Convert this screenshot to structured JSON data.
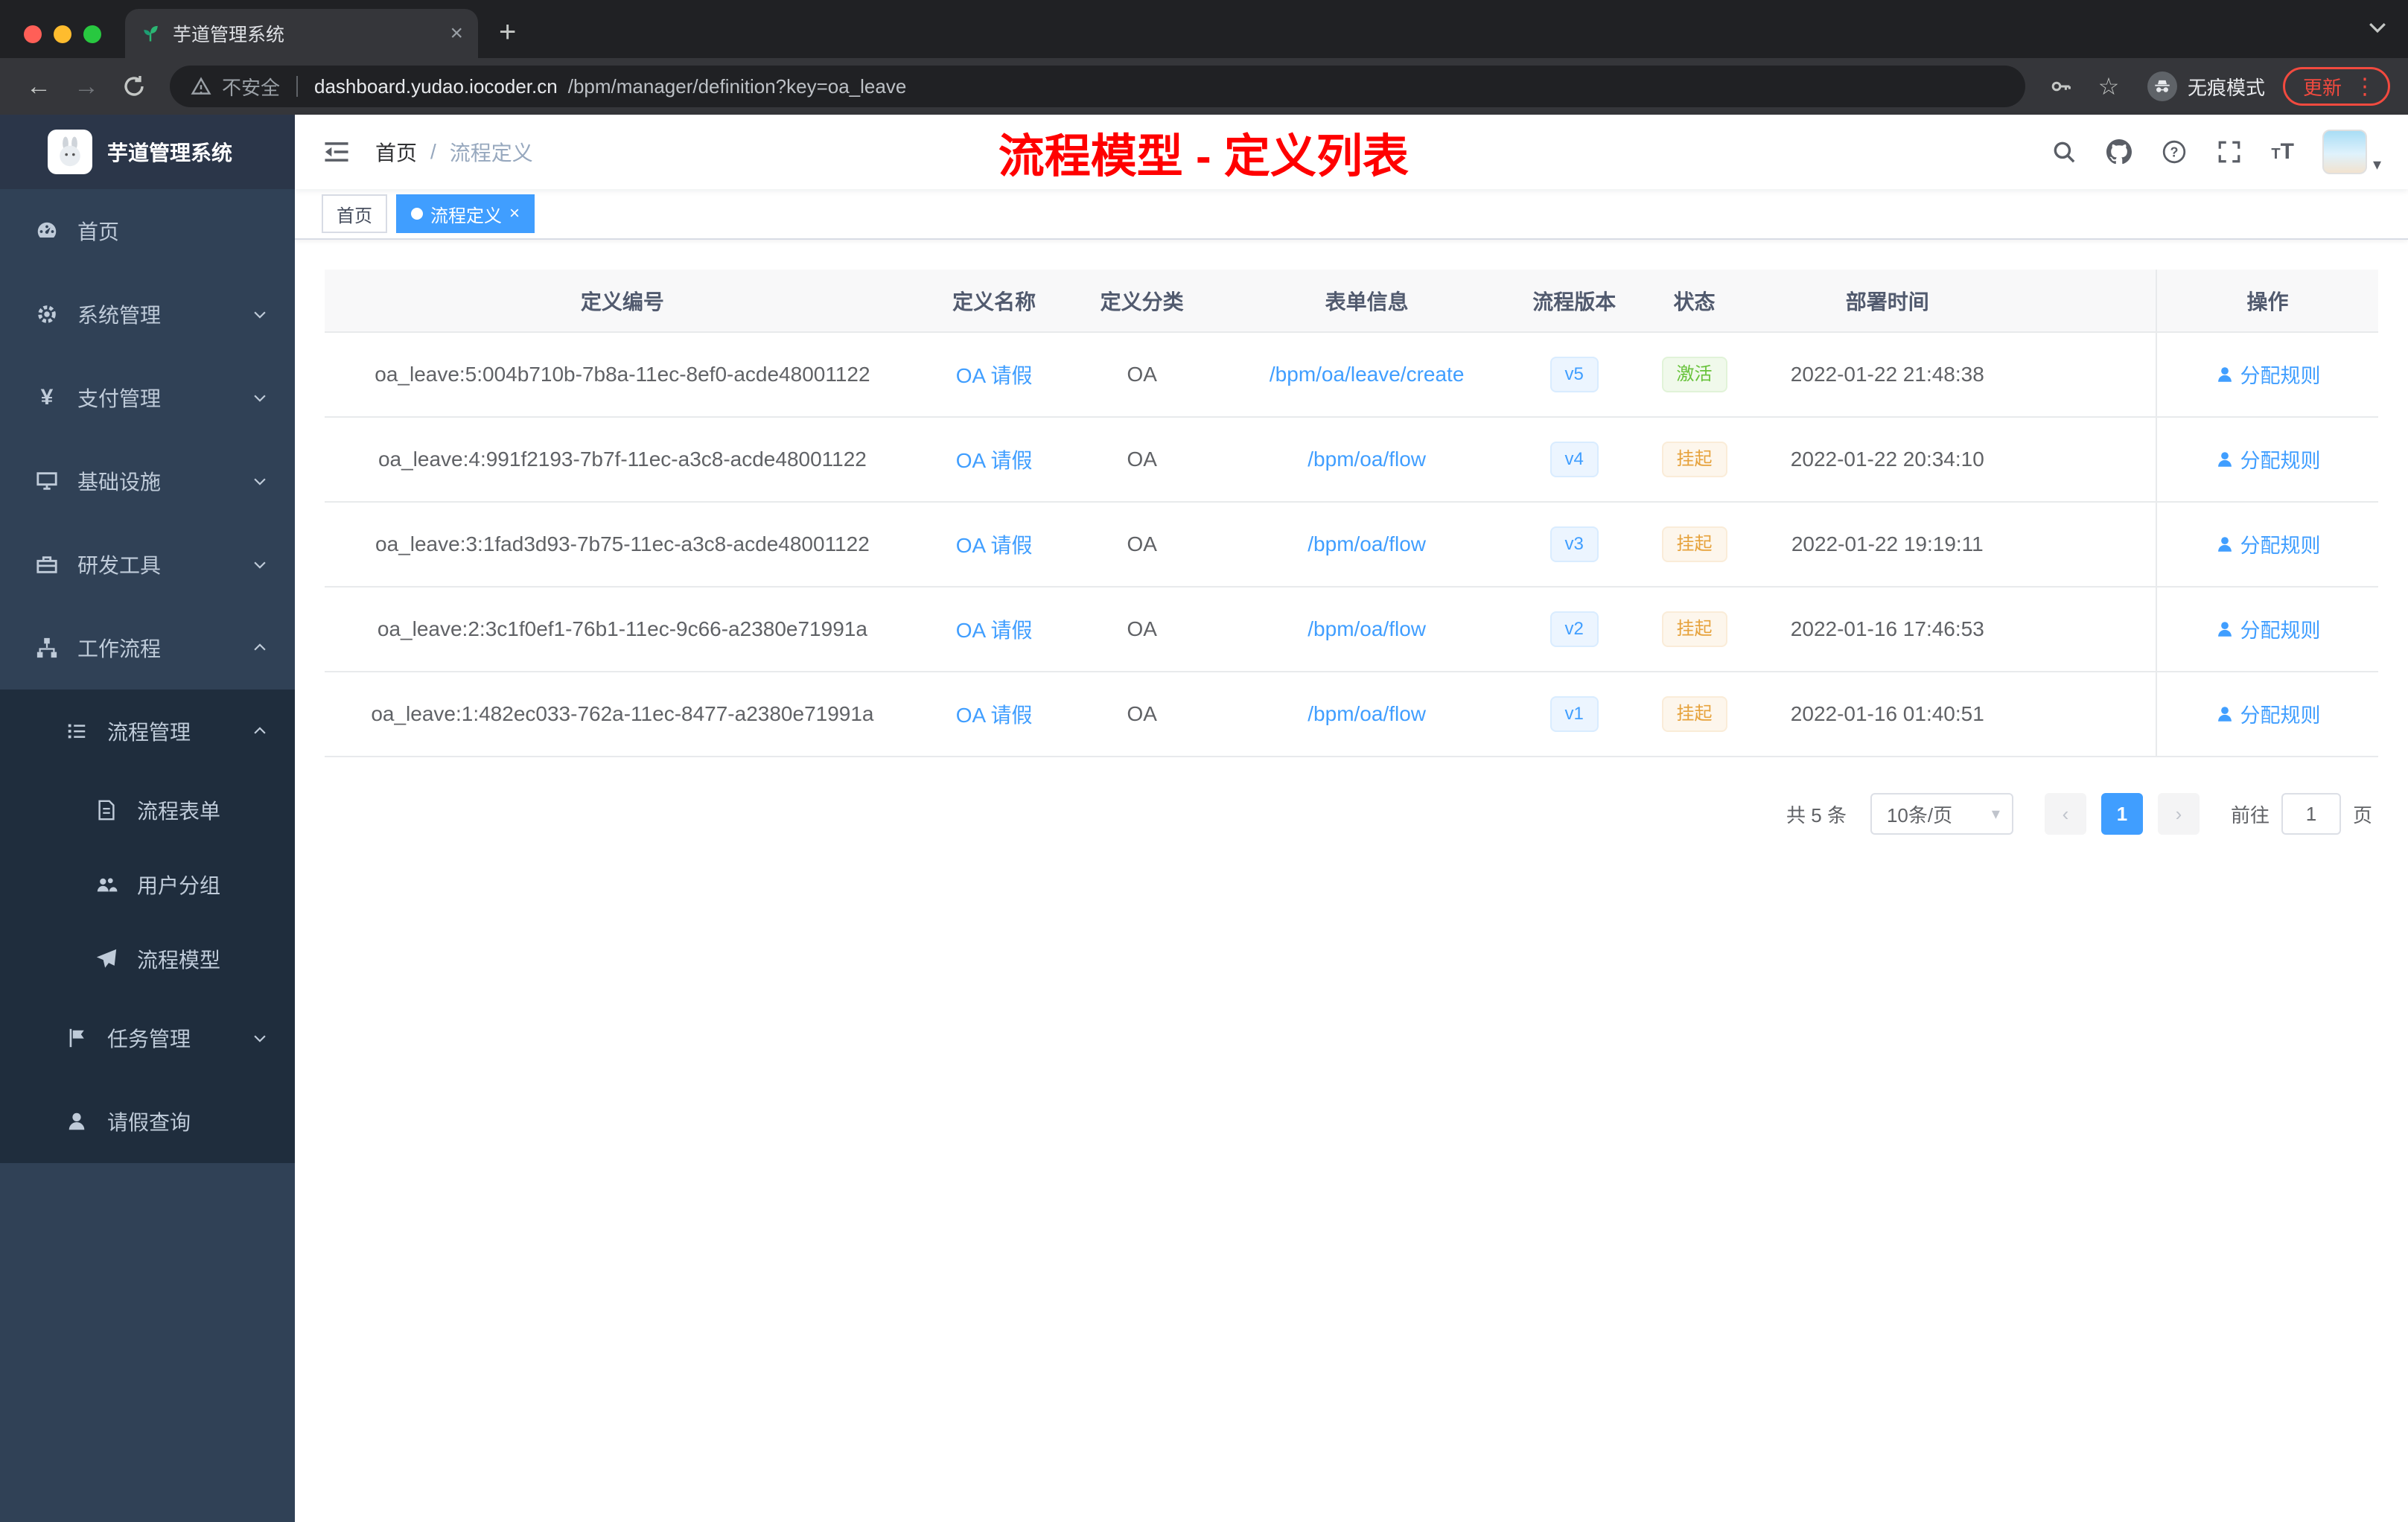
{
  "browser": {
    "tab_title": "芋道管理系统",
    "security_label": "不安全",
    "url_host": "dashboard.yudao.iocoder.cn",
    "url_path": "/bpm/manager/definition?key=oa_leave",
    "incognito_label": "无痕模式",
    "update_label": "更新"
  },
  "sidebar": {
    "logo_title": "芋道管理系统",
    "items": [
      {
        "label": "首页"
      },
      {
        "label": "系统管理"
      },
      {
        "label": "支付管理"
      },
      {
        "label": "基础设施"
      },
      {
        "label": "研发工具"
      },
      {
        "label": "工作流程"
      },
      {
        "label": "流程管理"
      },
      {
        "label": "流程表单"
      },
      {
        "label": "用户分组"
      },
      {
        "label": "流程模型"
      },
      {
        "label": "任务管理"
      },
      {
        "label": "请假查询"
      }
    ]
  },
  "header": {
    "breadcrumb_home": "首页",
    "breadcrumb_separator": "/",
    "breadcrumb_current": "流程定义",
    "annotation_title": "流程模型 - 定义列表"
  },
  "tags": {
    "items": [
      {
        "label": "首页"
      },
      {
        "label": "流程定义"
      }
    ]
  },
  "table": {
    "columns": [
      "定义编号",
      "定义名称",
      "定义分类",
      "表单信息",
      "流程版本",
      "状态",
      "部署时间",
      "操作"
    ],
    "rows": [
      {
        "id": "oa_leave:5:004b710b-7b8a-11ec-8ef0-acde48001122",
        "name": "OA 请假",
        "category": "OA",
        "form": "/bpm/oa/leave/create",
        "version": "v5",
        "status": "激活",
        "status_type": "active",
        "deploy_time": "2022-01-22 21:48:38",
        "action": "分配规则"
      },
      {
        "id": "oa_leave:4:991f2193-7b7f-11ec-a3c8-acde48001122",
        "name": "OA 请假",
        "category": "OA",
        "form": "/bpm/oa/flow",
        "version": "v4",
        "status": "挂起",
        "status_type": "suspended",
        "deploy_time": "2022-01-22 20:34:10",
        "action": "分配规则"
      },
      {
        "id": "oa_leave:3:1fad3d93-7b75-11ec-a3c8-acde48001122",
        "name": "OA 请假",
        "category": "OA",
        "form": "/bpm/oa/flow",
        "version": "v3",
        "status": "挂起",
        "status_type": "suspended",
        "deploy_time": "2022-01-22 19:19:11",
        "action": "分配规则"
      },
      {
        "id": "oa_leave:2:3c1f0ef1-76b1-11ec-9c66-a2380e71991a",
        "name": "OA 请假",
        "category": "OA",
        "form": "/bpm/oa/flow",
        "version": "v2",
        "status": "挂起",
        "status_type": "suspended",
        "deploy_time": "2022-01-16 17:46:53",
        "action": "分配规则"
      },
      {
        "id": "oa_leave:1:482ec033-762a-11ec-8477-a2380e71991a",
        "name": "OA 请假",
        "category": "OA",
        "form": "/bpm/oa/flow",
        "version": "v1",
        "status": "挂起",
        "status_type": "suspended",
        "deploy_time": "2022-01-16 01:40:51",
        "action": "分配规则"
      }
    ]
  },
  "pagination": {
    "total": "共 5 条",
    "page_size": "10条/页",
    "current_page": "1",
    "goto_label": "前往",
    "goto_value": "1",
    "goto_unit": "页"
  },
  "colors": {
    "accent": "#409eff",
    "success": "#67c23a",
    "warning": "#e6a23c",
    "annotation_red": "#ff0000",
    "sidebar_bg": "#304156",
    "submenu_bg": "#1f2d3d"
  }
}
